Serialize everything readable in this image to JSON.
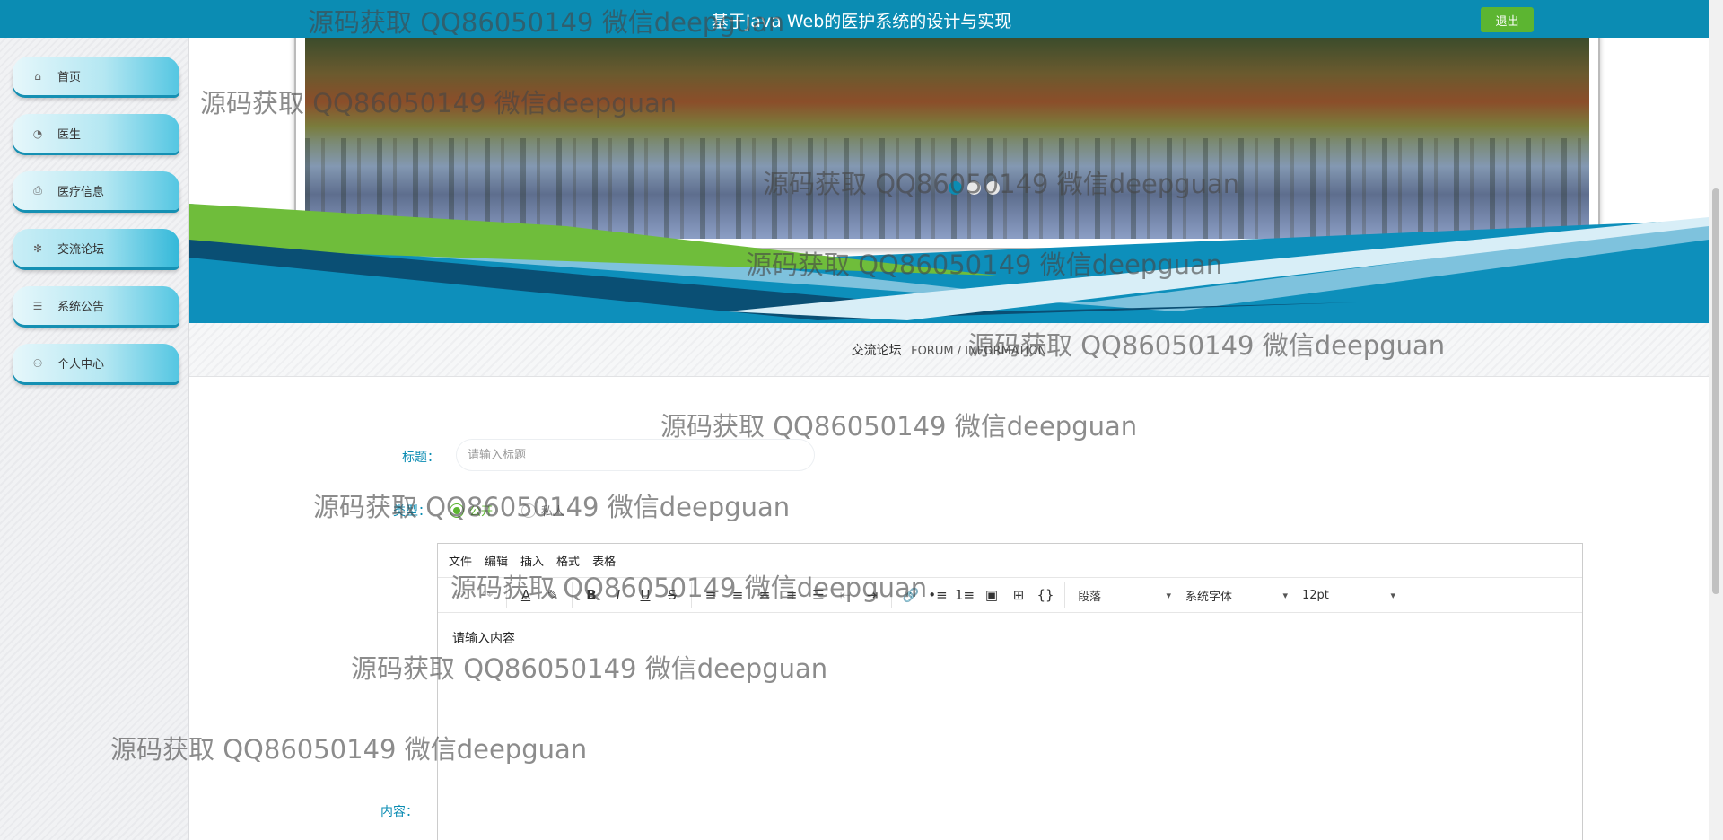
{
  "header": {
    "title": "基于Java Web的医护系统的设计与实现",
    "logout_label": "退出"
  },
  "sidebar": {
    "items": [
      {
        "label": "首页",
        "icon": "home-icon",
        "glyph": "⌂"
      },
      {
        "label": "医生",
        "icon": "dashboard-icon",
        "glyph": "◔"
      },
      {
        "label": "医疗信息",
        "icon": "printer-icon",
        "glyph": "⎙"
      },
      {
        "label": "交流论坛",
        "icon": "snowflake-icon",
        "glyph": "✻",
        "active": true
      },
      {
        "label": "系统公告",
        "icon": "sliders-icon",
        "glyph": "☰"
      },
      {
        "label": "个人中心",
        "icon": "user-icon",
        "glyph": "⚇"
      }
    ]
  },
  "banner": {
    "carousel_dots": 3,
    "active_dot": 0
  },
  "breadcrumb": {
    "title": "交流论坛",
    "subtitle": "FORUM / INFORMATION"
  },
  "form": {
    "title_label": "标题：",
    "title_placeholder": "请输入标题",
    "type_label": "类型：",
    "type_options": [
      "公开",
      "私人"
    ],
    "type_selected": "公开",
    "content_label": "内容："
  },
  "editor": {
    "menus": [
      "文件",
      "编辑",
      "插入",
      "格式",
      "表格"
    ],
    "block_format": "段落",
    "font_family": "系统字体",
    "font_size": "12pt",
    "placeholder": "请输入内容"
  },
  "watermark": {
    "text": "源码获取 QQ86050149 微信deepguan"
  },
  "colors": {
    "primary": "#0b8cb3",
    "accent_green": "#5cb531"
  }
}
